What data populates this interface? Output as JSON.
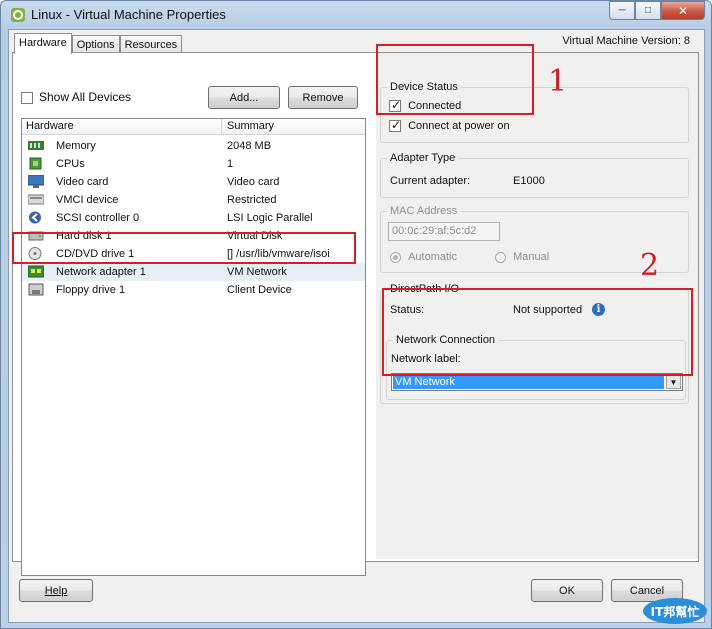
{
  "window": {
    "title": "Linux - Virtual Machine Properties",
    "minimize_glyph": "─",
    "maximize_glyph": "□",
    "close_glyph": "✕"
  },
  "tabs": [
    {
      "label": "Hardware",
      "active": true
    },
    {
      "label": "Options",
      "active": false
    },
    {
      "label": "Resources",
      "active": false
    }
  ],
  "vm_version": "Virtual Machine Version: 8",
  "hardware": {
    "show_all_devices_label": "Show All Devices",
    "show_all_devices_checked": false,
    "add_label": "Add...",
    "remove_label": "Remove",
    "columns": [
      "Hardware",
      "Summary"
    ],
    "devices": [
      {
        "name": "Memory",
        "summary": "2048 MB",
        "icon": "memory-icon"
      },
      {
        "name": "CPUs",
        "summary": "1",
        "icon": "cpu-icon"
      },
      {
        "name": "Video card",
        "summary": "Video card",
        "icon": "video-card-icon"
      },
      {
        "name": "VMCI device",
        "summary": "Restricted",
        "icon": "vmci-device-icon"
      },
      {
        "name": "SCSI controller 0",
        "summary": "LSI Logic Parallel",
        "icon": "scsi-controller-icon"
      },
      {
        "name": "Hard disk 1",
        "summary": "Virtual Disk",
        "icon": "hard-disk-icon"
      },
      {
        "name": "CD/DVD drive 1",
        "summary": "[] /usr/lib/vmware/isoi",
        "icon": "cd-dvd-icon"
      },
      {
        "name": "Network adapter 1",
        "summary": "VM Network",
        "icon": "network-adapter-icon",
        "selected": true
      },
      {
        "name": "Floppy drive 1",
        "summary": "Client Device",
        "icon": "floppy-drive-icon"
      }
    ]
  },
  "device_status": {
    "title": "Device Status",
    "connected_label": "Connected",
    "connected_checked": true,
    "connect_power_on_label": "Connect at power on",
    "connect_power_on_checked": true
  },
  "adapter_type": {
    "title": "Adapter Type",
    "current_label": "Current adapter:",
    "current_value": "E1000"
  },
  "mac_address": {
    "title": "MAC Address",
    "value": "00:0c:29:af:5c:d2",
    "automatic_label": "Automatic",
    "manual_label": "Manual",
    "selected": "Automatic"
  },
  "directpath": {
    "title": "DirectPath I/O",
    "status_label": "Status:",
    "status_value": "Not supported"
  },
  "network_connection": {
    "title": "Network Connection",
    "label": "Network label:",
    "selected": "VM Network"
  },
  "footer": {
    "help_label": "Help",
    "ok_label": "OK",
    "cancel_label": "Cancel"
  },
  "annotations": {
    "marker1": "1",
    "marker2": "2",
    "color": "#d0202a"
  },
  "watermark": {
    "text": "IT邦幫忙"
  }
}
